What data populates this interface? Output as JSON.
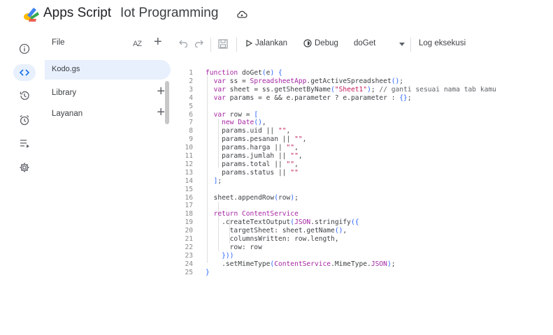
{
  "header": {
    "app_name": "Apps Script",
    "project_name": "Iot Programming"
  },
  "rail": {
    "items": [
      "overview",
      "editor",
      "triggers-history",
      "triggers",
      "executions",
      "settings"
    ]
  },
  "panel": {
    "files_label": "File",
    "sort_label": "AZ",
    "file_items": [
      "Kodo.gs"
    ],
    "library_label": "Library",
    "services_label": "Layanan"
  },
  "toolbar": {
    "run_label": "Jalankan",
    "debug_label": "Debug",
    "function_select": "doGet",
    "log_label": "Log eksekusi"
  },
  "editor": {
    "line_numbers": [
      "1",
      "2",
      "3",
      "4",
      "5",
      "6",
      "7",
      "8",
      "9",
      "10",
      "11",
      "12",
      "13",
      "14",
      "15",
      "16",
      "17",
      "18",
      "19",
      "20",
      "21",
      "22",
      "23",
      "24",
      "25"
    ],
    "lines": [
      "function doGet(e) {",
      "  var ss = SpreadsheetApp.getActiveSpreadsheet();",
      "  var sheet = ss.getSheetByName(\"Sheet1\"); // ganti sesuai nama tab kamu",
      "  var params = e && e.parameter ? e.parameter : {};",
      "",
      "  var row = [",
      "    new Date(),",
      "    params.uid || \"\",",
      "    params.pesanan || \"\",",
      "    params.harga || \"\",",
      "    params.jumlah || \"\",",
      "    params.total || \"\",",
      "    params.status || \"\"",
      "  ];",
      "",
      "  sheet.appendRow(row);",
      "",
      "  return ContentService",
      "    .createTextOutput(JSON.stringify({",
      "      targetSheet: sheet.getName(),",
      "      columnsWritten: row.length,",
      "      row: row",
      "    }))",
      "    .setMimeType(ContentService.MimeType.JSON);",
      "}"
    ]
  }
}
